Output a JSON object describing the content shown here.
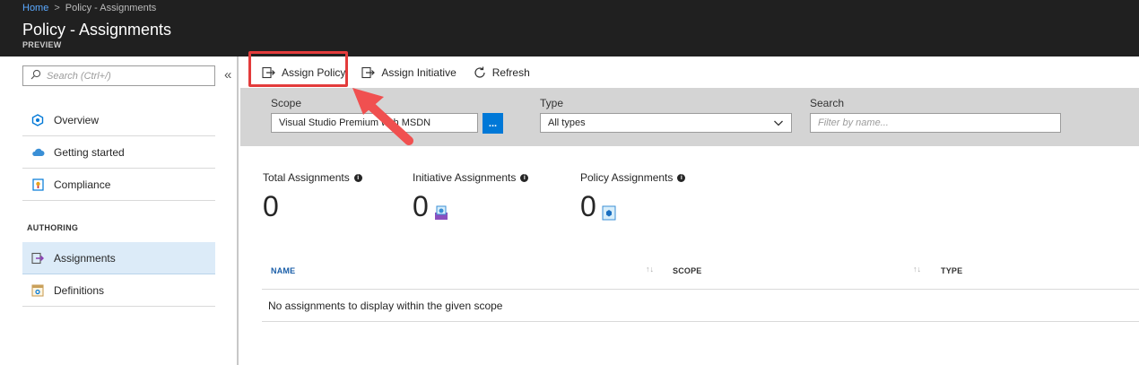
{
  "breadcrumb": {
    "home": "Home",
    "separator": ">",
    "current": "Policy - Assignments"
  },
  "header": {
    "title": "Policy - Assignments",
    "subtitle": "PREVIEW"
  },
  "sidebar": {
    "search_placeholder": "Search (Ctrl+/)",
    "collapse_glyph": "«",
    "items": [
      {
        "label": "Overview",
        "icon": "overview-icon"
      },
      {
        "label": "Getting started",
        "icon": "cloud-icon"
      },
      {
        "label": "Compliance",
        "icon": "compliance-icon"
      }
    ],
    "section_label": "AUTHORING",
    "authoring_items": [
      {
        "label": "Assignments",
        "icon": "assignment-icon",
        "active": true
      },
      {
        "label": "Definitions",
        "icon": "definitions-icon"
      }
    ]
  },
  "toolbar": {
    "assign_policy": "Assign Policy",
    "assign_initiative": "Assign Initiative",
    "refresh": "Refresh"
  },
  "filters": {
    "scope_label": "Scope",
    "scope_value": "Visual Studio Premium with MSDN",
    "scope_button": "...",
    "type_label": "Type",
    "type_value": "All types",
    "search_label": "Search",
    "search_placeholder": "Filter by name..."
  },
  "stats": [
    {
      "label": "Total Assignments",
      "value": "0"
    },
    {
      "label": "Initiative Assignments",
      "value": "0"
    },
    {
      "label": "Policy Assignments",
      "value": "0"
    }
  ],
  "table": {
    "columns": [
      "NAME",
      "SCOPE",
      "TYPE"
    ],
    "empty_message": "No assignments to display within the given scope"
  },
  "colors": {
    "accent": "#0078d7",
    "highlight": "#e33b3b",
    "header_bg": "#202020",
    "active_nav": "#dcebf8"
  }
}
